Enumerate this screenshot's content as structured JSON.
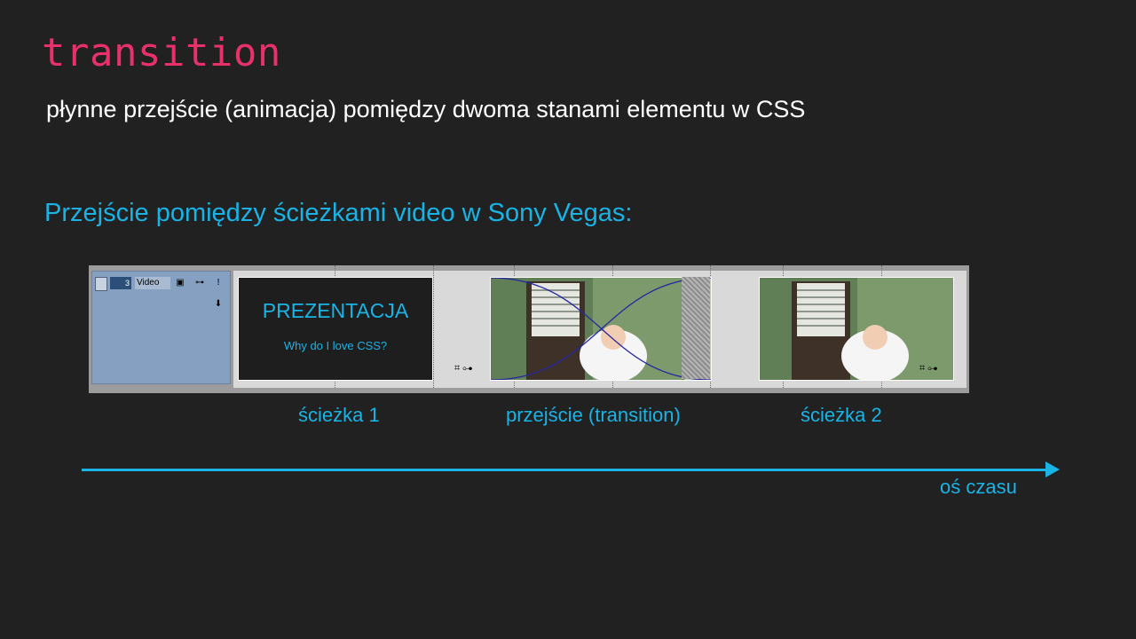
{
  "slide": {
    "title": "transition",
    "subtitle": "płynne przejście (animacja) pomiędzy dwoma stanami elementu w CSS",
    "heading": "Przejście pomiędzy ścieżkami video w Sony Vegas:"
  },
  "timeline": {
    "track_number": "3",
    "track_name": "Video",
    "clip1_title": "PREZENTACJA",
    "clip1_subtitle": "Why do I love CSS?"
  },
  "labels": {
    "track1": "ścieżka 1",
    "transition": "przejście (transition)",
    "track2": "ścieżka 2",
    "axis": "oś czasu"
  },
  "colors": {
    "background": "#212121",
    "title": "#e8316b",
    "accent": "#1ab3e6"
  },
  "icons": [
    "crop-icon",
    "pan-icon",
    "expand-icon",
    "compositing-icon",
    "mute-icon"
  ]
}
